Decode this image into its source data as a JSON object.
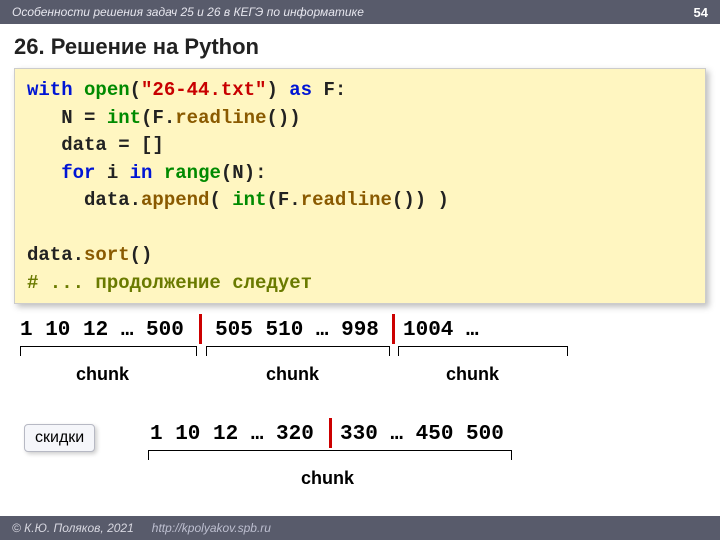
{
  "header": {
    "breadcrumb": "Особенности решения задач 25 и 26 в КЕГЭ по информатике",
    "page": "54"
  },
  "title": "26. Решение на Python",
  "code": {
    "l1a": "with",
    "l1b": "open",
    "l1c": "(",
    "l1d": "\"26-44.txt\"",
    "l1e": ")",
    "l1f": "as",
    "l1g": " F:",
    "l2a": "   N = ",
    "l2b": "int",
    "l2c": "(F.",
    "l2d": "readline",
    "l2e": "())",
    "l3": "   data = []",
    "l4a": "   ",
    "l4b": "for",
    "l4c": " i ",
    "l4d": "in",
    "l4e": " ",
    "l4f": "range",
    "l4g": "(N):",
    "l5a": "     data.",
    "l5b": "append",
    "l5c": "( ",
    "l5d": "int",
    "l5e": "(F.",
    "l5f": "readline",
    "l5g": "()) )",
    "l6": "",
    "l7a": "data.",
    "l7b": "sort",
    "l7c": "()",
    "l8": "# ... продолжение следует"
  },
  "row1": {
    "seg1": "1 10 12 … 500",
    "seg2": "505 510 … 998",
    "seg3": "1004 …"
  },
  "labels": {
    "chunk": "chunk"
  },
  "skidki": "скидки",
  "row2": {
    "seg1": "1 10 12 … 320",
    "seg2": "330 … 450 500"
  },
  "footer": {
    "copyright": "© К.Ю. Поляков, 2021",
    "url": "http://kpolyakov.spb.ru"
  }
}
